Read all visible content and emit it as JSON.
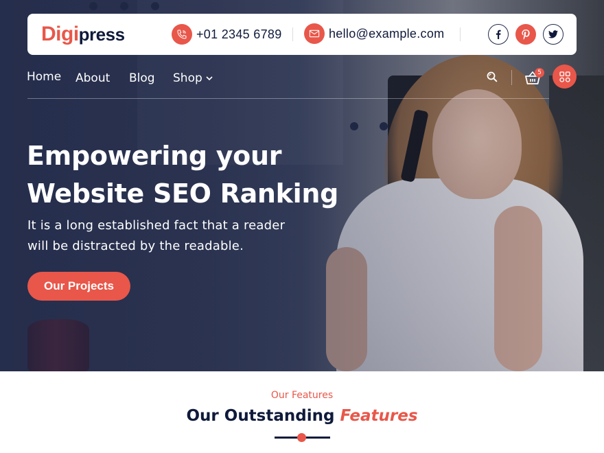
{
  "brand": {
    "part1": "Digi",
    "part2": "press"
  },
  "contact": {
    "phone": "+01 2345 6789",
    "email": "hello@example.com"
  },
  "socials": [
    {
      "name": "facebook",
      "glyph": "f"
    },
    {
      "name": "pinterest",
      "glyph": "P"
    },
    {
      "name": "twitter",
      "glyph": "t"
    }
  ],
  "nav": {
    "items": [
      "Home",
      "About",
      "Blog",
      "Shop"
    ],
    "cart_count": "5"
  },
  "hero": {
    "title_line1": "Empowering your",
    "title_line2": "Website SEO Ranking",
    "subtitle_line1": "It is a long established fact that a reader",
    "subtitle_line2": "will be distracted by the readable.",
    "cta_label": "Our Projects"
  },
  "features": {
    "kicker": "Our Features",
    "title_plain": "Our Outstanding",
    "title_accent": "Features"
  },
  "colors": {
    "accent": "#e8574a",
    "navy": "#0f1a3b"
  }
}
